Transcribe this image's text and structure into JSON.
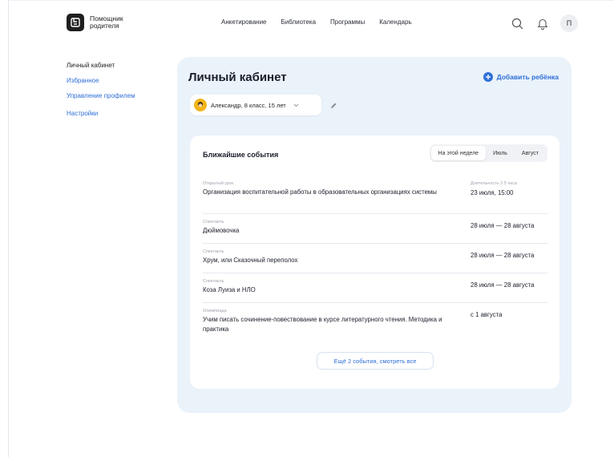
{
  "header": {
    "logo_line1": "Помощник",
    "logo_line2": "родителя",
    "nav": [
      "Анкетирование",
      "Библиотека",
      "Программы",
      "Календарь"
    ],
    "avatar_letter": "П"
  },
  "sidebar": {
    "items": [
      {
        "label": "Личный кабинет",
        "active": true
      },
      {
        "label": "Избранное"
      },
      {
        "label": "Управление профилем"
      },
      {
        "label": "Настройки"
      }
    ]
  },
  "main": {
    "title": "Личный кабинет",
    "add_child_label": "Добавить ребёнка",
    "child_selector": "Александр, 8 класс, 15 лет",
    "events": {
      "title": "Ближайшие события",
      "tabs": [
        {
          "label": "На этой неделе",
          "active": true
        },
        {
          "label": "Июль"
        },
        {
          "label": "Август"
        }
      ],
      "items": [
        {
          "category": "Открытый урок",
          "title": "Организация воспитательной работы в образовательных организациях системы",
          "meta": "Длительность 2.5 часа",
          "date": "23 июля, 15:00"
        },
        {
          "category": "Спектакль",
          "title": "Дюймовочка",
          "meta": "",
          "date": "28 июля — 28 августа"
        },
        {
          "category": "Спектакль",
          "title": "Хрум, или Сказочный переполох",
          "meta": "",
          "date": "28 июля — 28 августа"
        },
        {
          "category": "Спектакль",
          "title": "Коза Луиза и НЛО",
          "meta": "",
          "date": "28 июля — 28 августа"
        },
        {
          "category": "Олимпиада",
          "title": "Учим писать сочинение-повествование в курсе литературного чтения. Методика и практика",
          "meta": "",
          "date": "с 1 августа"
        }
      ],
      "more_label": "Ещё 2 события, смотреть все"
    }
  },
  "colors": {
    "accent": "#2f6fd8",
    "panel_bg": "#eaf2fa",
    "child_avatar": "#f2b418"
  }
}
